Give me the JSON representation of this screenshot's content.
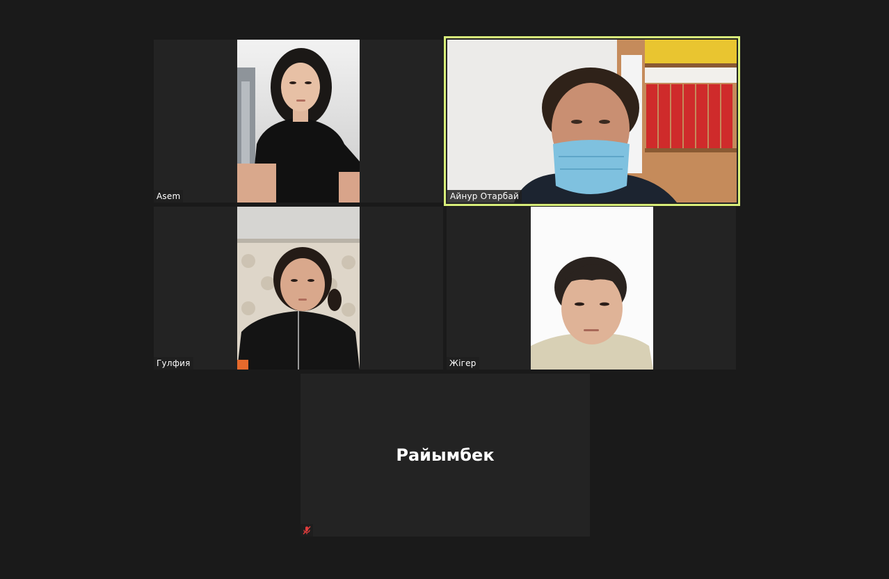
{
  "participants": [
    {
      "name": "Asem",
      "has_video": true,
      "active_speaker": false
    },
    {
      "name": "Айнур Отарбай",
      "has_video": true,
      "active_speaker": true
    },
    {
      "name": "Гулфия",
      "has_video": true,
      "active_speaker": false
    },
    {
      "name": "Жігер",
      "has_video": true,
      "active_speaker": false
    },
    {
      "name": "Райымбек",
      "has_video": false,
      "active_speaker": false,
      "muted": true
    }
  ],
  "colors": {
    "background": "#1a1a1a",
    "tile": "#232323",
    "active_speaker_border": "#d8ee7a",
    "muted_icon": "#e03c3c"
  },
  "icons": {
    "muted": "microphone-muted-icon"
  }
}
